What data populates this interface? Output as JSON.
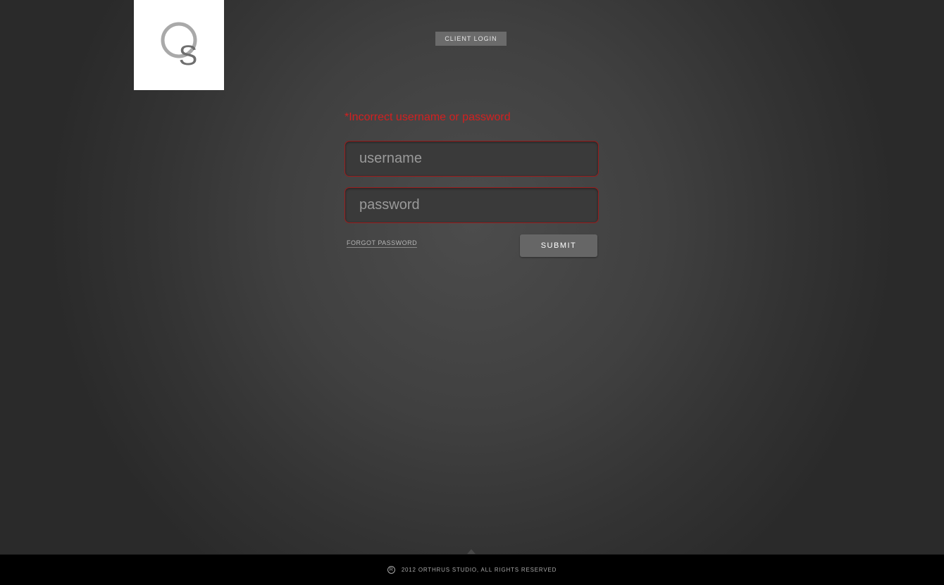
{
  "header": {
    "logo": {
      "text": "OS",
      "icon": "os-logo"
    },
    "client_login_label": "CLIENT LOGIN"
  },
  "login_form": {
    "error_message": "*Incorrect username or password",
    "username": {
      "placeholder": "username",
      "value": ""
    },
    "password": {
      "placeholder": "password",
      "value": ""
    },
    "forgot_password_label": "FORGOT PASSWORD",
    "submit_label": "SUBMIT"
  },
  "footer": {
    "registered_icon": "R",
    "copyright": "2012 ORTHRUS STUDIO, ALL RIGHTS RESERVED"
  },
  "colors": {
    "error": "#d32020",
    "field_border": "#9b1c1c",
    "logo_bg": "#ffffff",
    "footer_bg": "#000000",
    "button_bg": "#666666"
  }
}
